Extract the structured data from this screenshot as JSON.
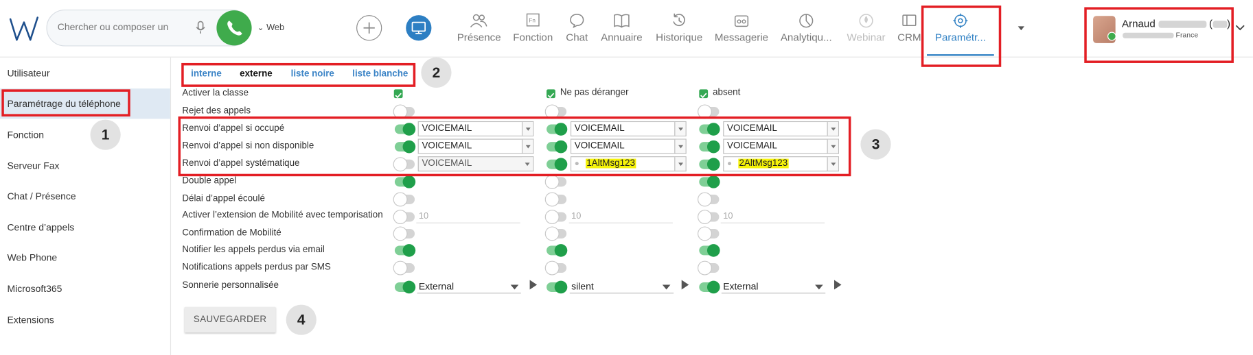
{
  "header": {
    "search_placeholder": "Chercher ou composer un",
    "web_label": "Web",
    "user": {
      "name": "Arnaud",
      "country": "France",
      "paren_open": "(",
      "paren_close": ")"
    }
  },
  "nav": [
    {
      "label": "Présence",
      "icon": "people-icon"
    },
    {
      "label": "Fonction",
      "icon": "fn-icon"
    },
    {
      "label": "Chat",
      "icon": "chat-bubble-icon"
    },
    {
      "label": "Annuaire",
      "icon": "book-icon"
    },
    {
      "label": "Historique",
      "icon": "history-icon"
    },
    {
      "label": "Messagerie",
      "icon": "voicemail-icon"
    },
    {
      "label": "Analytiqu...",
      "icon": "pie-chart-icon"
    },
    {
      "label": "Webinar",
      "icon": "webinar-icon",
      "disabled": true
    },
    {
      "label": "CRM",
      "icon": "crm-icon"
    },
    {
      "label": "Paramétr...",
      "icon": "gear-icon",
      "active": true
    }
  ],
  "sidebar": {
    "items": [
      {
        "label": "Utilisateur"
      },
      {
        "label": "Paramétrage du téléphone",
        "active": true
      },
      {
        "label": "Fonction"
      },
      {
        "label": "Serveur Fax"
      },
      {
        "label": "Chat / Présence"
      },
      {
        "label": "Centre d’appels"
      },
      {
        "label": "Web Phone"
      },
      {
        "label": "Microsoft365"
      },
      {
        "label": "Extensions"
      }
    ]
  },
  "annotations": [
    "1",
    "2",
    "3",
    "4"
  ],
  "tabs": [
    {
      "label": "interne"
    },
    {
      "label": "externe",
      "selected": true
    },
    {
      "label": "liste noire"
    },
    {
      "label": "liste blanche"
    }
  ],
  "columns": [
    {
      "label": "Activer la classe",
      "checked": true
    },
    {
      "label": "Ne pas déranger",
      "checked": true
    },
    {
      "label": "absent",
      "checked": true
    }
  ],
  "rows": {
    "reject": {
      "label": "Rejet des appels",
      "toggles": [
        false,
        false,
        false
      ]
    },
    "busy": {
      "label": "Renvoi d’appel si occupé",
      "toggles": [
        true,
        true,
        true
      ],
      "values": [
        "VOICEMAIL",
        "VOICEMAIL",
        "VOICEMAIL"
      ]
    },
    "unavail": {
      "label": "Renvoi d’appel si non disponible",
      "toggles": [
        true,
        true,
        true
      ],
      "values": [
        "VOICEMAIL",
        "VOICEMAIL",
        "VOICEMAIL"
      ]
    },
    "always": {
      "label": "Renvoi d’appel systématique",
      "toggles": [
        false,
        true,
        true
      ],
      "values": [
        "VOICEMAIL",
        "1AltMsg123",
        "2AltMsg123"
      ]
    },
    "double": {
      "label": "Double appel",
      "toggles": [
        true,
        false,
        true
      ]
    },
    "timeout": {
      "label": "Délai d’appel écoulé",
      "toggles": [
        false,
        false,
        false
      ]
    },
    "mobility": {
      "label": "Activer l’extension de Mobilité avec temporisation",
      "toggles": [
        false,
        false,
        false
      ],
      "values": [
        "10",
        "10",
        "10"
      ]
    },
    "mobconfirm": {
      "label": "Confirmation de Mobilité",
      "toggles": [
        false,
        false,
        false
      ]
    },
    "email": {
      "label": "Notifier les appels perdus via email",
      "toggles": [
        true,
        true,
        true
      ]
    },
    "sms": {
      "label": "Notifications appels perdus par SMS",
      "toggles": [
        false,
        false,
        false
      ]
    },
    "ring": {
      "label": "Sonnerie personnalisée",
      "toggles": [
        true,
        true,
        true
      ],
      "values": [
        "External",
        "silent",
        "External"
      ]
    }
  },
  "save_label": "SAUVEGARDER",
  "colors": {
    "accent": "#2d7fc3",
    "green": "#1f9f4a",
    "annotation_red": "#e31e24",
    "highlight": "#f5f20a"
  }
}
